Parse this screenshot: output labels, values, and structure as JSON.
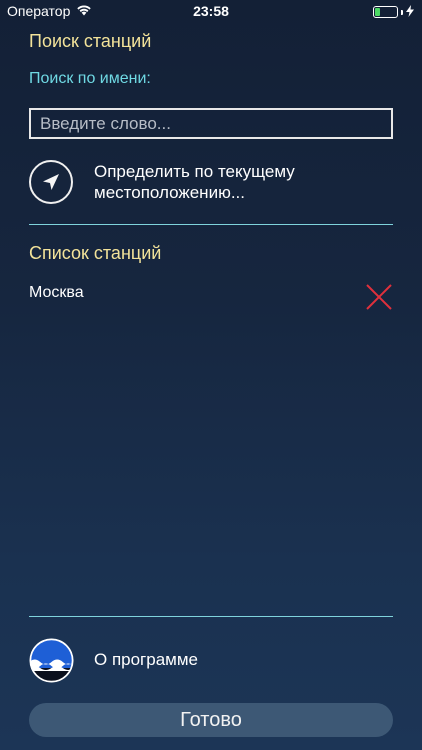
{
  "status_bar": {
    "carrier": "Оператор",
    "time": "23:58",
    "battery_percent": 25,
    "wifi_icon": "wifi-icon",
    "battery_icon": "battery-icon",
    "charging_icon": "charging-bolt-icon"
  },
  "search": {
    "title": "Поиск станций",
    "by_name_label": "Поиск по имени:",
    "placeholder": "Введите слово...",
    "value": "",
    "locate_icon": "location-arrow-icon",
    "locate_label_line1": "Определить по текущему",
    "locate_label_line2": "местоположению..."
  },
  "stations": {
    "title": "Список станций",
    "items": [
      {
        "name": "Москва",
        "delete_icon": "close-x-icon"
      }
    ]
  },
  "about": {
    "logo_icon": "app-logo-icon",
    "label": "О программе"
  },
  "done_label": "Готово",
  "colors": {
    "accent_yellow": "#f3e39a",
    "accent_cyan": "#6fd9e3",
    "delete_red": "#e0303c",
    "button_bg": "#3d5875"
  }
}
